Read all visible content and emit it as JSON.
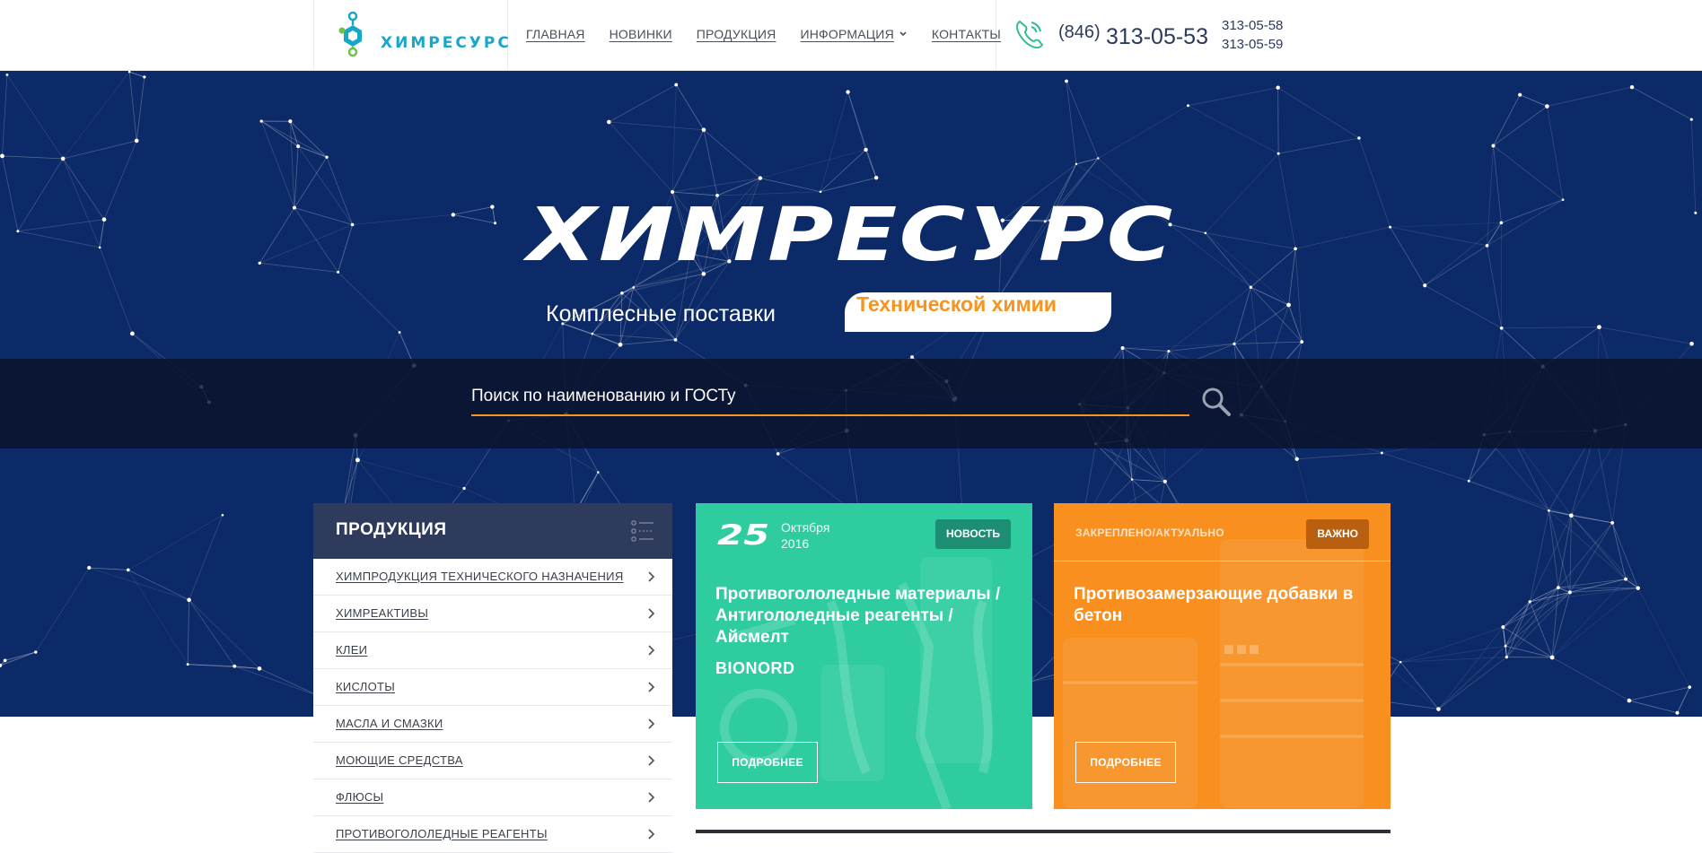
{
  "header": {
    "logo_text": "ХИМРЕСУРС",
    "nav": [
      {
        "label": "ГЛАВНАЯ"
      },
      {
        "label": "НОВИНКИ"
      },
      {
        "label": "ПРОДУКЦИЯ"
      },
      {
        "label": "ИНФОРМАЦИЯ",
        "has_dropdown": true
      },
      {
        "label": "КОНТАКТЫ"
      }
    ],
    "phone": {
      "icon": "phone-icon",
      "code": "(846)",
      "main": "313-05-53",
      "alt": [
        "313-05-58",
        "313-05-59"
      ]
    }
  },
  "hero": {
    "title": "ХИМРЕСУРС",
    "subtitle": "Комплесные поставки",
    "badge": "Технической химии",
    "search": {
      "placeholder": "Поиск по наименованию и ГОСТу",
      "icon": "search-icon"
    }
  },
  "product_menu": {
    "title": "ПРОДУКЦИЯ",
    "items": [
      {
        "label": "ХИМПРОДУКЦИЯ ТЕХНИЧЕСКОГО НАЗНАЧЕНИЯ"
      },
      {
        "label": "ХИМРЕАКТИВЫ"
      },
      {
        "label": "КЛЕИ"
      },
      {
        "label": "КИСЛОТЫ"
      },
      {
        "label": "МАСЛА И СМАЗКИ"
      },
      {
        "label": "МОЮЩИЕ СРЕДСТВА"
      },
      {
        "label": "ФЛЮСЫ"
      },
      {
        "label": "ПРОТИВОГОЛОЛЕДНЫЕ РЕАГЕНТЫ"
      }
    ]
  },
  "cards": {
    "news": {
      "day": "25",
      "month": "Октября",
      "year": "2016",
      "tag": "НОВОСТЬ",
      "title": "Противогололедные материалы / Антигололедные реагенты / Айсмелт",
      "source": "BIONORD",
      "button": "ПОДРОБНЕЕ"
    },
    "pinned": {
      "label": "ЗАКРЕПЛЕНО/АКТУАЛЬНО",
      "tag": "ВАЖНО",
      "title": "Противозамерзающие добавки в бетон",
      "button": "ПОДРОБНЕЕ"
    }
  },
  "colors": {
    "hero_bg": "#0d2a68",
    "accent_orange": "#f7931e",
    "news_green": "#2fcca0",
    "menu_head": "#2e3b5c",
    "logo_teal": "#18a7c9",
    "logo_green": "#6cc24a"
  }
}
